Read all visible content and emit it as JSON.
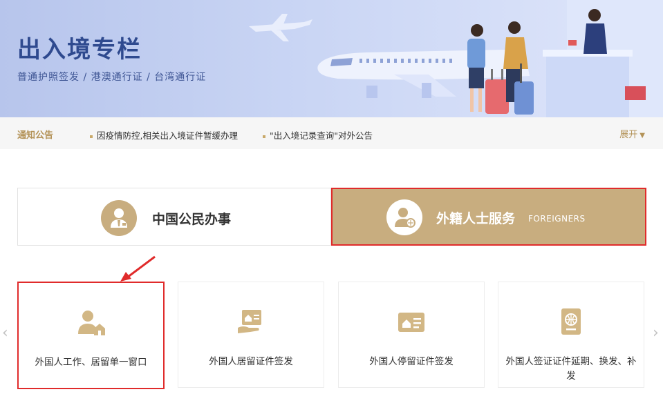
{
  "banner": {
    "title": "出入境专栏",
    "subtitle": "普通护照签发 / 港澳通行证 / 台湾通行证"
  },
  "notice": {
    "label": "通知公告",
    "items": [
      "因疫情防控,相关出入境证件暂缓办理",
      "\"出入境记录查询\"对外公告"
    ],
    "expand": "展开"
  },
  "tabs": [
    {
      "label": "中国公民办事",
      "icon": "citizen-icon",
      "active": false
    },
    {
      "label": "外籍人士服务",
      "sub": "FOREIGNERS",
      "icon": "foreigner-icon",
      "active": true
    }
  ],
  "cards": [
    {
      "label": "外国人工作、居留单一窗口",
      "icon": "person-home-icon",
      "selected": true
    },
    {
      "label": "外国人居留证件签发",
      "icon": "residence-card-hand-icon",
      "selected": false
    },
    {
      "label": "外国人停留证件签发",
      "icon": "stay-card-icon",
      "selected": false
    },
    {
      "label": "外国人签证证件延期、换发、补发",
      "icon": "passport-globe-icon",
      "selected": false
    }
  ],
  "nav": {
    "prev": "‹",
    "next": "›"
  },
  "colors": {
    "gold": "#c8ad7f",
    "highlight": "#e02b2b",
    "bannerBlue": "#2f4a8f"
  }
}
